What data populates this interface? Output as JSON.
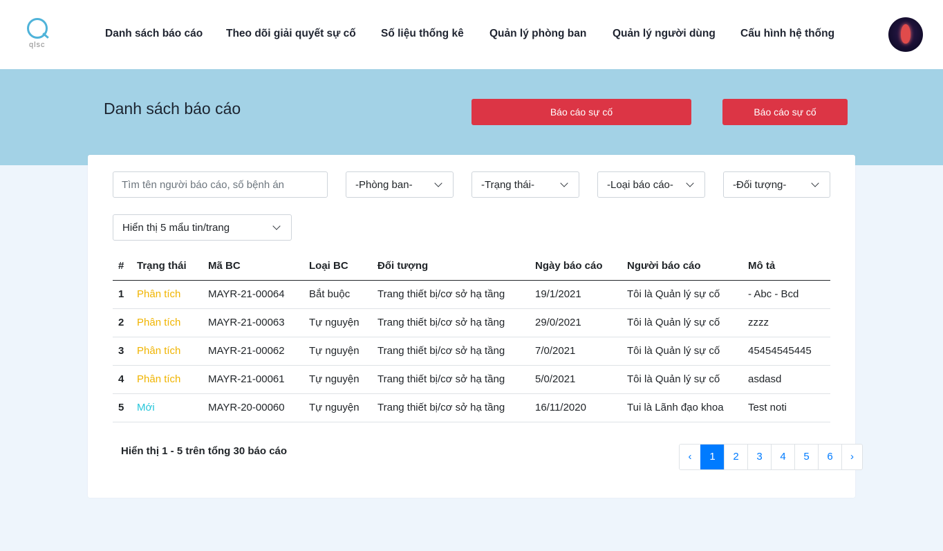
{
  "brand": {
    "logo_text": "qlsc"
  },
  "nav": {
    "items": [
      "Danh sách báo cáo",
      "Theo dõi giải quyết sự cố",
      "Số liệu thống kê",
      "Quản lý phòng ban",
      "Quản lý người dùng",
      "Cấu hình hệ thống"
    ]
  },
  "header": {
    "title": "Danh sách báo cáo",
    "button_primary": "Báo cáo sự cố",
    "button_secondary": "Báo cáo sự cố"
  },
  "filters": {
    "search_placeholder": "Tìm tên người báo cáo, số bệnh án",
    "department": "-Phòng ban-",
    "status": "-Trạng thái-",
    "report_type": "-Loại báo cáo-",
    "subject": "-Đối tượng-",
    "page_size": "Hiển thị 5 mẩu tin/trang"
  },
  "table": {
    "headers": [
      "#",
      "Trạng thái",
      "Mã BC",
      "Loại BC",
      "Đối tượng",
      "Ngày báo cáo",
      "Người báo cáo",
      "Mô tả"
    ],
    "rows": [
      [
        "1",
        "Phân tích",
        "MAYR-21-00064",
        "Bắt buộc",
        "Trang thiết bị/cơ sở hạ tầng",
        "19/1/2021",
        "Tôi là Quản lý sự cố",
        "- Abc - Bcd"
      ],
      [
        "2",
        "Phân tích",
        "MAYR-21-00063",
        "Tự nguyện",
        "Trang thiết bị/cơ sở hạ tầng",
        "29/0/2021",
        "Tôi là Quản lý sự cố",
        "zzzz"
      ],
      [
        "3",
        "Phân tích",
        "MAYR-21-00062",
        "Tự nguyện",
        "Trang thiết bị/cơ sở hạ tầng",
        "7/0/2021",
        "Tôi là Quản lý sự cố",
        "45454545445"
      ],
      [
        "4",
        "Phân tích",
        "MAYR-21-00061",
        "Tự nguyện",
        "Trang thiết bị/cơ sở hạ tầng",
        "5/0/2021",
        "Tôi là Quản lý sự cố",
        "asdasd"
      ],
      [
        "5",
        "Mới",
        "MAYR-20-00060",
        "Tự nguyện",
        "Trang thiết bị/cơ sở hạ tầng",
        "16/11/2020",
        "Tui là Lãnh đạo khoa",
        "Test noti"
      ]
    ],
    "status_colors": {
      "Phân tích": "#f0b400",
      "Mới": "#26c6da"
    }
  },
  "footer": {
    "summary": "Hiển thị 1 - 5 trên tổng 30 báo cáo",
    "pagination": {
      "prev": "‹",
      "pages": [
        "1",
        "2",
        "3",
        "4",
        "5",
        "6"
      ],
      "current": "1",
      "next": "›"
    }
  },
  "colors": {
    "accent_red": "#dc3545",
    "banner": "#a3d2e6",
    "link_blue": "#007bff",
    "background": "#eef5fc"
  }
}
